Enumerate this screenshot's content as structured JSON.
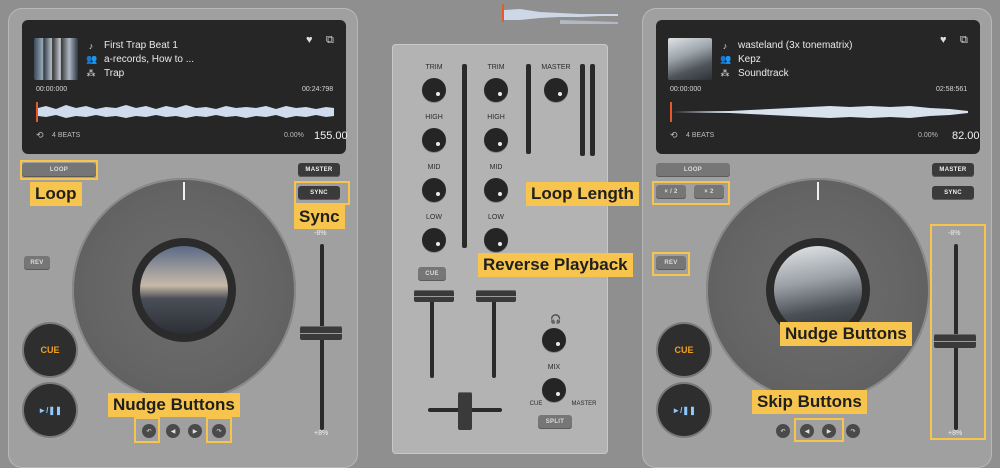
{
  "left_deck": {
    "track": {
      "title": "First Trap Beat 1",
      "artist": "a-records, How to ...",
      "genre": "Trap"
    },
    "time_elapsed": "00:00:000",
    "time_total": "00:24:798",
    "beats": "4 BEATS",
    "pitch_pct": "0.00%",
    "bpm": "155.00",
    "buttons": {
      "loop": "LOOP",
      "master": "MASTER",
      "sync": "SYNC",
      "rev": "REV",
      "cue": "CUE",
      "play_pause": "►/❚❚"
    },
    "pitch_scale_top": "-8%",
    "pitch_scale_bottom": "+8%"
  },
  "right_deck": {
    "track": {
      "title": "wasteland (3x tonematrix)",
      "artist": "Kepz",
      "genre": "Soundtrack"
    },
    "time_elapsed": "00:00:000",
    "time_total": "02:58:561",
    "beats": "4 BEATS",
    "pitch_pct": "0.00%",
    "bpm": "82.00",
    "buttons": {
      "loop": "LOOP",
      "master": "MASTER",
      "sync": "SYNC",
      "half": "× / 2",
      "double": "× 2",
      "rev": "REV",
      "cue": "CUE",
      "play_pause": "►/❚❚"
    },
    "pitch_scale_top": "-8%",
    "pitch_scale_bottom": "+8%"
  },
  "mixer": {
    "ch1": {
      "trim": "TRIM",
      "high": "HIGH",
      "mid": "MID",
      "low": "LOW",
      "cue": "CUE"
    },
    "ch2": {
      "trim": "TRIM",
      "high": "HIGH",
      "mid": "MID",
      "low": "LOW"
    },
    "master": "MASTER",
    "headphone_icon": "headphones-icon",
    "mix": "MIX",
    "cue_label": "CUE",
    "master_label": "MASTER",
    "split": "SPLIT"
  },
  "annotations": {
    "loop": "Loop",
    "sync": "Sync",
    "loop_length": "Loop Length",
    "reverse_playback": "Reverse Playback",
    "nudge_left": "Nudge Buttons",
    "nudge_right": "Nudge Buttons",
    "skip": "Skip Buttons"
  },
  "colors": {
    "accent": "#f7c54d",
    "cue_text": "#f0a020",
    "screen_bg": "#262626",
    "playhead": "#e2522d"
  }
}
